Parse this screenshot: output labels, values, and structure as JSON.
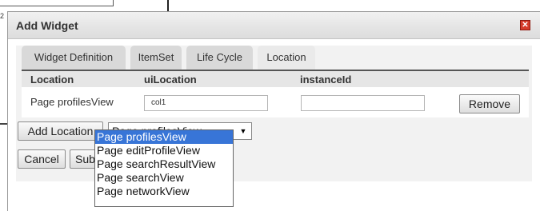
{
  "background": {
    "field_text": "",
    "side_digit": "2"
  },
  "dialog": {
    "title": "Add Widget",
    "close_glyph": "✕",
    "tabs": [
      {
        "label": "Widget Definition",
        "active": false
      },
      {
        "label": "ItemSet",
        "active": false
      },
      {
        "label": "Life Cycle",
        "active": false
      },
      {
        "label": "Location",
        "active": true
      }
    ],
    "columns": {
      "location": "Location",
      "ui_location": "uiLocation",
      "instance_id": "instanceId"
    },
    "row": {
      "location": "Page profilesView",
      "ui_location_value": "col1",
      "instance_id_value": "",
      "remove_label": "Remove"
    },
    "add_location_label": "Add Location",
    "select": {
      "selected": "Page profilesView",
      "options": [
        "Page profilesView",
        "Page editProfileView",
        "Page searchResultView",
        "Page searchView",
        "Page networkView"
      ]
    },
    "cancel_label": "Cancel",
    "submit_label": "Subı"
  },
  "colors": {
    "accent_selected": "#3875d7",
    "close_button": "#d63b2a"
  }
}
